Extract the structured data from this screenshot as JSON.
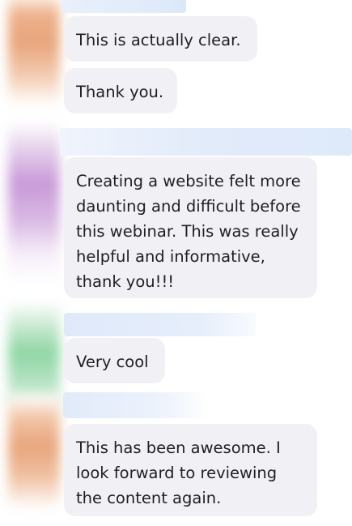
{
  "colors": {
    "bubble_bg": "#f1f1f5",
    "text": "#1e1e24",
    "name_blur": "#dde8f8"
  },
  "messages": [
    {
      "group": 1,
      "text": "This is actually clear."
    },
    {
      "group": 1,
      "text": "Thank you."
    },
    {
      "group": 2,
      "text": "Creating a website felt more daunting and difficult before this webinar. This was really helpful and informative, thank you!!!"
    },
    {
      "group": 3,
      "text": "Very cool"
    },
    {
      "group": 4,
      "text": "This has been awesome. I look forward to reviewing the content again."
    }
  ],
  "avatars": [
    {
      "color": "#e8a57c"
    },
    {
      "color": "#c89ad8"
    },
    {
      "color": "#8fd6a4"
    },
    {
      "color": "#e8a57c"
    }
  ]
}
